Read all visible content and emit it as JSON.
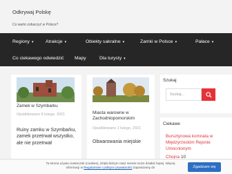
{
  "site": {
    "title": "Odkrywaj Polskę",
    "tagline": "Co warto zobaczyć w Polsce?"
  },
  "nav": {
    "items": [
      {
        "label": "Regiony",
        "has_dropdown": true
      },
      {
        "label": "Atrakcje",
        "has_dropdown": true
      },
      {
        "label": "Obiekty sakralne",
        "has_dropdown": true
      },
      {
        "label": "Zamki w Polsce",
        "has_dropdown": true
      },
      {
        "label": "Pałace",
        "has_dropdown": true
      },
      {
        "label": "Co ciekawego odwiedzić",
        "has_dropdown": false
      },
      {
        "label": "Mapy",
        "has_dropdown": false
      },
      {
        "label": "Dla turysty",
        "has_dropdown": true
      }
    ]
  },
  "posts": [
    {
      "title": "Zamek w Szymbarku",
      "meta": "Opublikowano 6 lutego, 2021",
      "excerpt": "Ruiny zamku w Szymbarku, zamek przetrwał wszystko, ale nie przetrwał"
    },
    {
      "title": "Miasta warowne w Zachodniopomorskim",
      "meta": "Opublikowano 1 lutego, 2021",
      "excerpt": "Obwarowania miejskie"
    }
  ],
  "sidebar": {
    "search": {
      "title": "Szukaj",
      "placeholder": "Szukaj..."
    },
    "recent": {
      "title": "Ciekawe",
      "items": [
        "Bursztynowa komnata w Międzyrzeckim Rejonie Umocnionym",
        "Chojna"
      ],
      "count_label": "10"
    }
  },
  "cookie": {
    "text_before": "Ta strona używa ciasteczek (cookies), dzięki którym nasz serwis może działać lepiej. Więcej informacji w",
    "link": "Regulaminie i polityce prywatności",
    "text_after": "Zapraszamy do",
    "button": "Zgadzam się"
  },
  "colors": {
    "nav_bg": "#262626",
    "accent": "#e53238",
    "cookie_button": "#2d6fc2"
  }
}
